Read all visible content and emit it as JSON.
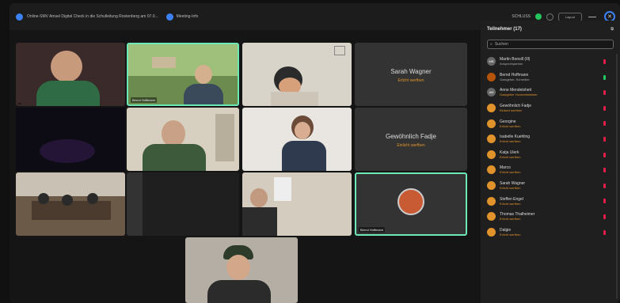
{
  "window": {
    "meeting_title": "Online-SMV Amsel Digital Check in die Schulleitung Rostenberg am 07.0...",
    "meeting_info_label": "Meeting-Info",
    "record_label": "SCHLUSS",
    "layout_label": "Layout",
    "colors": {
      "accent": "#3b82f6",
      "active_speaker": "#6ee7b7",
      "status_orange": "#e0922b",
      "mic_muted": "#e11d48",
      "mic_on": "#22c55e"
    }
  },
  "grid": {
    "tiles": [
      {
        "id": "t1",
        "label": ""
      },
      {
        "id": "t2",
        "label": "Bernd Hoffmann"
      },
      {
        "id": "t3",
        "label": ""
      },
      {
        "id": "t4",
        "big_name": "Sarah Wagner",
        "status": "Erlicht werfben",
        "label": ""
      },
      {
        "id": "t5",
        "label": ""
      },
      {
        "id": "t6",
        "label": ""
      },
      {
        "id": "t7",
        "label": ""
      },
      {
        "id": "t8",
        "big_name": "Gewöhnlich Fadje",
        "status": "Einlicht werfben",
        "label": ""
      },
      {
        "id": "t9",
        "label": ""
      },
      {
        "id": "t10",
        "label": ""
      },
      {
        "id": "t11",
        "label": ""
      },
      {
        "id": "t12",
        "label": "Bernd Hoffmann"
      },
      {
        "id": "t13",
        "label": ""
      }
    ]
  },
  "panel": {
    "title": "Teilnehmer (17)",
    "search_placeholder": "Suchen",
    "participants": [
      {
        "name": "Martin Bonsill (Ill)",
        "sub": "Ansprechpartner",
        "sub_color": "#aaa",
        "avatar": "MB",
        "avatar_color": "#666",
        "mic": "muted"
      },
      {
        "name": "Bernd Hoffmann",
        "sub": "Gastgeber, Schreiber",
        "sub_color": "#aaa",
        "avatar": "",
        "avatar_color": "#b45309",
        "mic": "on"
      },
      {
        "name": "Anne Mendelsheit",
        "sub": "Gastgeber Hochreitmeister",
        "sub_color": "#e0922b",
        "avatar": "AM",
        "avatar_color": "#666",
        "mic": "muted"
      },
      {
        "name": "Gewöhnlich Fadje",
        "sub": "Einlicht werfben",
        "sub_color": "#e0922b",
        "avatar": "",
        "avatar_color": "#e0922b",
        "mic": "muted"
      },
      {
        "name": "Georgine",
        "sub": "Erlicht werfben",
        "sub_color": "#e0922b",
        "avatar": "",
        "avatar_color": "#e0922b",
        "mic": "muted"
      },
      {
        "name": "Isabelle Kuehling",
        "sub": "Erlicht werfben",
        "sub_color": "#e0922b",
        "avatar": "",
        "avatar_color": "#e0922b",
        "mic": "muted"
      },
      {
        "name": "Katja Ulerk",
        "sub": "Erlicht werfben",
        "sub_color": "#e0922b",
        "avatar": "",
        "avatar_color": "#e0922b",
        "mic": "muted"
      },
      {
        "name": "Marco",
        "sub": "Erlicht werfben",
        "sub_color": "#e0922b",
        "avatar": "",
        "avatar_color": "#e0922b",
        "mic": "muted"
      },
      {
        "name": "Sarah Wagner",
        "sub": "Erlicht werfben",
        "sub_color": "#e0922b",
        "avatar": "",
        "avatar_color": "#e0922b",
        "mic": "muted"
      },
      {
        "name": "Steffen Engel",
        "sub": "Erlicht werfben",
        "sub_color": "#e0922b",
        "avatar": "",
        "avatar_color": "#e0922b",
        "mic": "muted"
      },
      {
        "name": "Thomas Thalheimer",
        "sub": "Erlicht werfben",
        "sub_color": "#e0922b",
        "avatar": "",
        "avatar_color": "#e0922b",
        "mic": "muted"
      },
      {
        "name": "Dalgie",
        "sub": "Erlicht werfben",
        "sub_color": "#e0922b",
        "avatar": "",
        "avatar_color": "#e0922b",
        "mic": "muted"
      }
    ]
  }
}
